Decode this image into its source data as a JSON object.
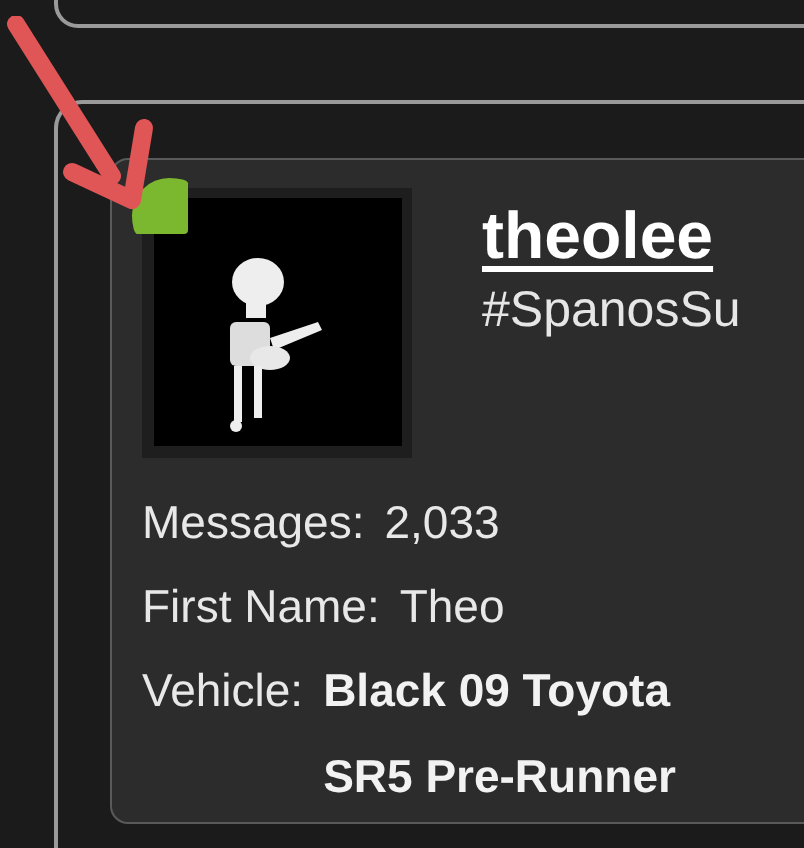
{
  "user": {
    "username": "theolee",
    "online": true,
    "subtitle": "#SpanosSu"
  },
  "fields": [
    {
      "label": "Messages:",
      "value": "2,033",
      "kind": "plain"
    },
    {
      "label": "First Name:",
      "value": "Theo",
      "kind": "plain"
    },
    {
      "label": "Vehicle:",
      "value_lines": [
        "Black 09 Toyota",
        "SR5 Pre-Runner"
      ],
      "kind": "bold"
    }
  ]
}
